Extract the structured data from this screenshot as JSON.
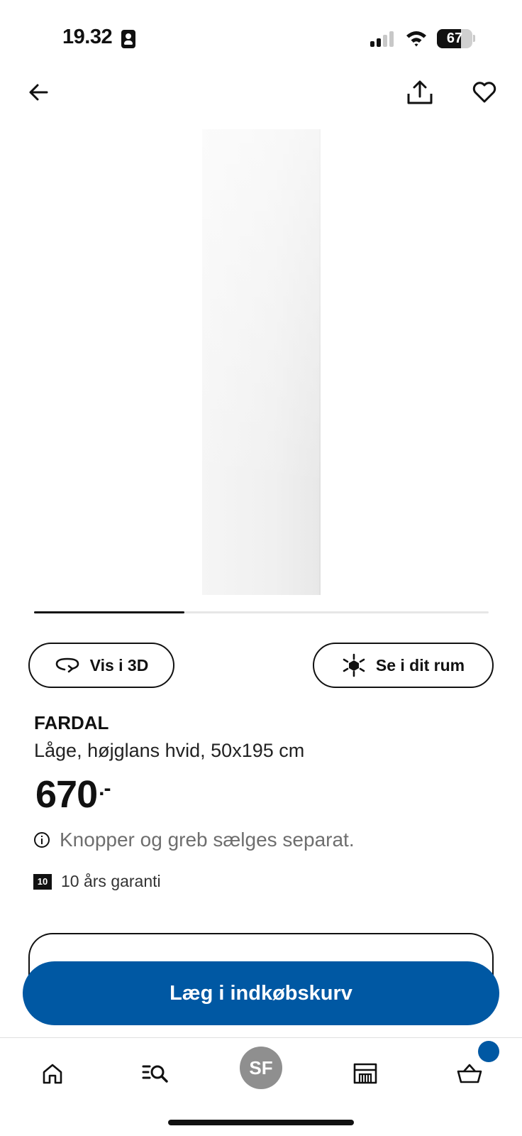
{
  "status_bar": {
    "time": "19.32",
    "battery_level": "67",
    "battery_fraction": 0.67
  },
  "nav": {
    "back_icon": "arrow-left-icon",
    "share_icon": "share-icon",
    "favorite_icon": "heart-icon"
  },
  "carousel": {
    "progress_fraction": 0.33
  },
  "actions": {
    "view_3d_label": "Vis i 3D",
    "view_3d_icon": "rotate-3d-icon",
    "see_room_label": "Se i dit rum",
    "see_room_icon": "ar-cube-icon"
  },
  "product": {
    "name": "FARDAL",
    "description": "Låge, højglans hvid, 50x195 cm",
    "price": "670",
    "price_suffix": ".-",
    "info_text": "Knopper og greb sælges separat.",
    "warranty_badge": "10",
    "warranty_text": "10 års garanti"
  },
  "cta": {
    "label": "Læg i indkøbskurv",
    "color": "#0058a3"
  },
  "tabbar": {
    "home_icon": "home-icon",
    "search_icon": "search-list-icon",
    "avatar_initials": "SF",
    "store_icon": "store-icon",
    "cart_icon": "basket-icon",
    "cart_badge_color": "#0058a3"
  }
}
